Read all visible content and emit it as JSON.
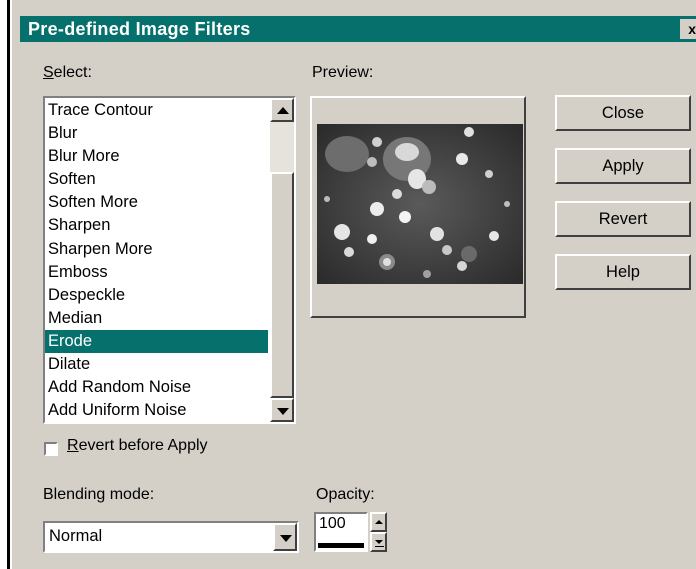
{
  "dialog": {
    "title": "Pre-defined Image Filters",
    "close_glyph": "x"
  },
  "colors": {
    "titlebar": "#06706c",
    "face": "#d4d0c8",
    "selection": "#06706c"
  },
  "select": {
    "label_prefix": "",
    "label_underlined": "S",
    "label_rest": "elect:",
    "items": [
      "Trace Contour",
      "Blur",
      "Blur More",
      "Soften",
      "Soften More",
      "Sharpen",
      "Sharpen More",
      "Emboss",
      "Despeckle",
      "Median",
      "Erode",
      "Dilate",
      "Add Random Noise",
      "Add Uniform Noise"
    ],
    "selected": "Erode"
  },
  "preview": {
    "label": "Preview:"
  },
  "buttons": {
    "close": "Close",
    "apply": "Apply",
    "revert": "Revert",
    "help": "Help"
  },
  "revert_checkbox": {
    "underlined": "R",
    "rest": "evert before Apply",
    "checked": false
  },
  "blending": {
    "label": "Blending mode:",
    "value": "Normal"
  },
  "opacity": {
    "label": "Opacity:",
    "value": "100"
  }
}
